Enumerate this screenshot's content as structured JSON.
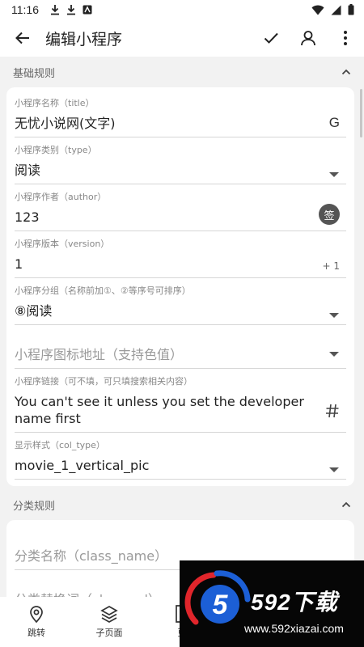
{
  "status_bar": {
    "time": "11:16"
  },
  "app_bar": {
    "title": "编辑小程序"
  },
  "sections": [
    {
      "title": "基础规则"
    },
    {
      "title": "分类规则"
    }
  ],
  "basic_fields": [
    {
      "label": "小程序名称（title）",
      "value": "无忧小说网(文字)",
      "trail": "G"
    },
    {
      "label": "小程序类别（type）",
      "value": "阅读"
    },
    {
      "label": "小程序作者（author）",
      "value": "123",
      "trail": "签"
    },
    {
      "label": "小程序版本（version）",
      "value": "1",
      "trail": "+ 1"
    },
    {
      "label": "小程序分组（名称前加①、②等序号可排序）",
      "value": "⑧阅读"
    },
    {
      "placeholder": "小程序图标地址（支持色值）"
    },
    {
      "label": "小程序链接（可不填，可只填搜索相关内容）",
      "value": "You can't see it unless you set the developer name first"
    },
    {
      "label": "显示样式（col_type）",
      "value": "movie_1_vertical_pic"
    }
  ],
  "class_fields": [
    {
      "placeholder": "分类名称（class_name）"
    },
    {
      "placeholder": "分类替换词（class_url）"
    }
  ],
  "bottom_nav": [
    {
      "label": "跳转",
      "icon": "location-pin-icon"
    },
    {
      "label": "子页面",
      "icon": "layers-icon"
    },
    {
      "label": "更",
      "icon": "document-icon"
    }
  ],
  "watermark": {
    "text": "592下载",
    "url": "www.592xiazai.com",
    "digit": "5"
  },
  "colors": {
    "accent_blue": "#1c5fd6",
    "accent_red": "#e0252b"
  }
}
